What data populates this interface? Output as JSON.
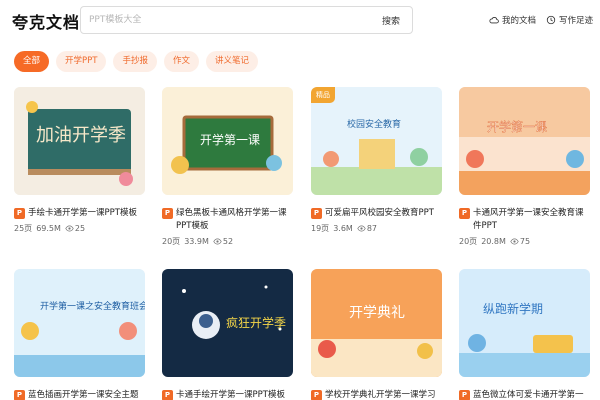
{
  "header": {
    "logo": "夸克文档",
    "search_placeholder": "PPT模板大全",
    "search_button": "搜索",
    "my_docs": "我的文档",
    "history": "写作足迹"
  },
  "tabs": [
    {
      "label": "全部",
      "active": true
    },
    {
      "label": "开学PPT",
      "active": false
    },
    {
      "label": "手抄报",
      "active": false
    },
    {
      "label": "作文",
      "active": false
    },
    {
      "label": "讲义笔记",
      "active": false
    }
  ],
  "cards": [
    {
      "title": "手绘卡通开学第一课PPT模板",
      "pages": "25页",
      "size": "69.5M",
      "views": "25",
      "badge": "",
      "thumb_text": "加油开学季"
    },
    {
      "title": "绿色黑板卡通风格开学第一课PPT模板",
      "pages": "20页",
      "size": "33.9M",
      "views": "52",
      "badge": "",
      "thumb_text": "开学第一课"
    },
    {
      "title": "可爱扁平风校园安全教育PPT",
      "pages": "19页",
      "size": "3.6M",
      "views": "87",
      "badge": "精品",
      "thumb_text": "校园安全教育"
    },
    {
      "title": "卡通风开学第一课安全教育课件PPT",
      "pages": "20页",
      "size": "20.8M",
      "views": "75",
      "badge": "",
      "thumb_text": "开学第一课"
    },
    {
      "title": "蓝色插画开学第一课安全主题班",
      "pages": "",
      "size": "",
      "views": "",
      "badge": "",
      "thumb_text": "开学第一课之安全教育班会"
    },
    {
      "title": "卡通手绘开学第一课PPT模板",
      "pages": "",
      "size": "",
      "views": "",
      "badge": "",
      "thumb_text": "疯狂开学季"
    },
    {
      "title": "学校开学典礼开学第一课学习动",
      "pages": "",
      "size": "",
      "views": "",
      "badge": "",
      "thumb_text": "开学典礼"
    },
    {
      "title": "蓝色微立体可爱卡通开学第一课",
      "pages": "",
      "size": "",
      "views": "",
      "badge": "",
      "thumb_text": "纵跑新学期"
    }
  ],
  "colors": {
    "accent": "#f66a26",
    "accent_light": "#fdeee6",
    "premium": "#f2a531"
  }
}
